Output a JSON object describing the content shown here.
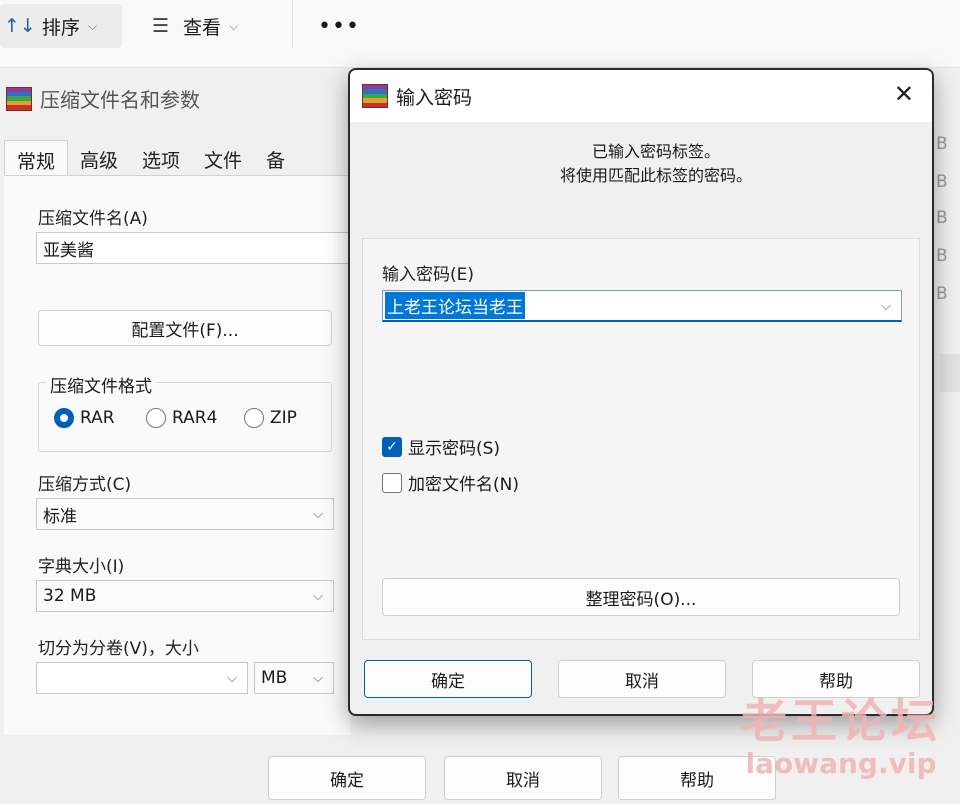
{
  "toolbar": {
    "sort_icon": "↑↓",
    "sort_label": "排序",
    "view_icon": "☰",
    "view_label": "查看",
    "more_label": "•••"
  },
  "bg_window": {
    "title": "压缩文件名和参数",
    "tabs": [
      "常规",
      "高级",
      "选项",
      "文件",
      "备"
    ],
    "archive_name_label": "压缩文件名(A)",
    "archive_name_value": "亚美酱",
    "profile_button": "配置文件(F)...",
    "format_group": "压缩文件格式",
    "formats": [
      "RAR",
      "RAR4",
      "ZIP"
    ],
    "selected_format": "RAR",
    "method_label": "压缩方式(C)",
    "method_value": "标准",
    "dict_label": "字典大小(I)",
    "dict_value": "32 MB",
    "split_label": "切分为分卷(V)，大小",
    "split_unit": "MB",
    "ok": "确定",
    "cancel": "取消",
    "help": "帮助",
    "right_edge_fragments": [
      "B",
      "B",
      "B",
      "B",
      "B"
    ]
  },
  "dialog": {
    "title": "输入密码",
    "close_glyph": "✕",
    "info_line1": "已输入密码标签。",
    "info_line2": "将使用匹配此标签的密码。",
    "password_label": "输入密码(E)",
    "password_value": "上老王论坛当老王",
    "show_password": "显示密码(S)",
    "show_password_checked": true,
    "encrypt_names": "加密文件名(N)",
    "encrypt_names_checked": false,
    "organize_button": "整理密码(O)...",
    "ok": "确定",
    "cancel": "取消",
    "help": "帮助",
    "accent_color": "#005fb8"
  },
  "watermark": {
    "line1": "老王论坛",
    "line2": "laowang.vip"
  }
}
